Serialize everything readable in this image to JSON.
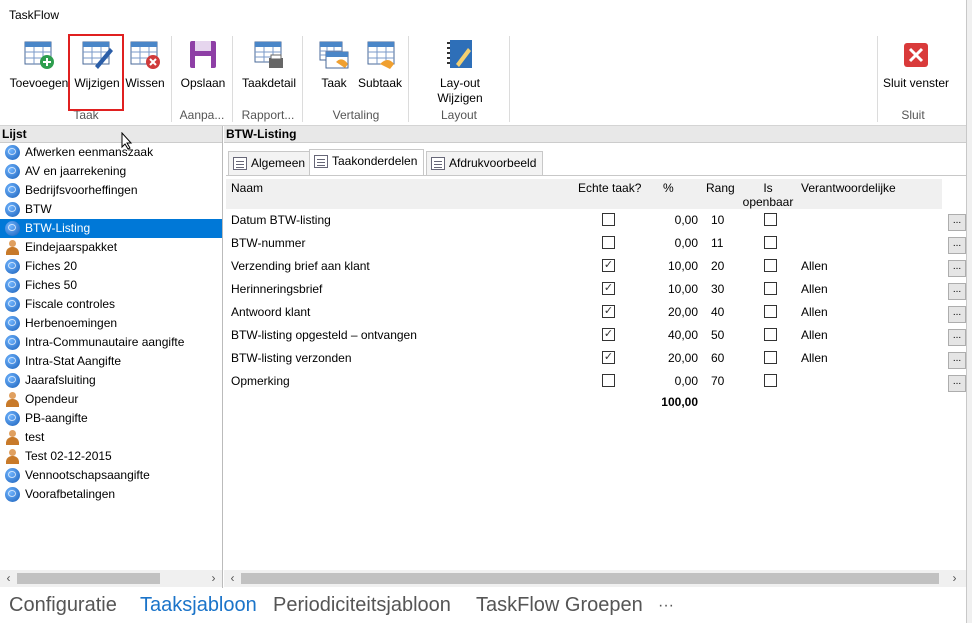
{
  "app": {
    "title": "TaskFlow"
  },
  "ribbon": {
    "buttons": {
      "add": "Toevoegen",
      "edit": "Wijzigen",
      "delete": "Wissen",
      "save": "Opslaan",
      "taskdetail": "Taakdetail",
      "task": "Taak",
      "subtask": "Subtaak",
      "layout": "Lay-out Wijzigen",
      "close": "Sluit venster"
    },
    "groups": {
      "task": "Taak",
      "adjust": "Aanpa...",
      "report": "Rapport...",
      "translation": "Vertaling",
      "layout": "Layout",
      "close": "Sluit"
    }
  },
  "list": {
    "header": "Lijst",
    "items": [
      {
        "label": "Afwerken eenmanszaak",
        "icon": "globe-icon"
      },
      {
        "label": "AV en jaarrekening",
        "icon": "globe-icon"
      },
      {
        "label": "Bedrijfsvoorheffingen",
        "icon": "globe-icon"
      },
      {
        "label": "BTW",
        "icon": "globe-icon"
      },
      {
        "label": "BTW-Listing",
        "icon": "globe-icon",
        "selected": true
      },
      {
        "label": "Eindejaarspakket",
        "icon": "person-icon"
      },
      {
        "label": "Fiches 20",
        "icon": "globe-icon"
      },
      {
        "label": "Fiches 50",
        "icon": "globe-icon"
      },
      {
        "label": "Fiscale controles",
        "icon": "globe-icon"
      },
      {
        "label": "Herbenoemingen",
        "icon": "globe-icon"
      },
      {
        "label": "Intra-Communautaire aangifte",
        "icon": "globe-icon"
      },
      {
        "label": "Intra-Stat Aangifte",
        "icon": "globe-icon"
      },
      {
        "label": "Jaarafsluiting",
        "icon": "globe-icon"
      },
      {
        "label": "Opendeur",
        "icon": "person-icon"
      },
      {
        "label": "PB-aangifte",
        "icon": "globe-icon"
      },
      {
        "label": "test",
        "icon": "person-icon"
      },
      {
        "label": "Test 02-12-2015",
        "icon": "person-icon"
      },
      {
        "label": "Vennootschapsaangifte",
        "icon": "globe-icon"
      },
      {
        "label": "Voorafbetalingen",
        "icon": "globe-icon"
      }
    ]
  },
  "detail": {
    "header": "BTW-Listing",
    "tabs": [
      {
        "label": "Algemeen"
      },
      {
        "label": "Taakonderdelen",
        "active": true
      },
      {
        "label": "Afdrukvoorbeeld"
      }
    ],
    "columns": {
      "name": "Naam",
      "real": "Echte taak?",
      "pct": "%",
      "rank": "Rang",
      "public": "Is openbaar",
      "resp": "Verantwoordelijke"
    },
    "rows": [
      {
        "name": "Datum BTW-listing",
        "real": false,
        "pct": "0,00",
        "rank": "10",
        "public": false,
        "resp": ""
      },
      {
        "name": "BTW-nummer",
        "real": false,
        "pct": "0,00",
        "rank": "11",
        "public": false,
        "resp": ""
      },
      {
        "name": "Verzending brief aan klant",
        "real": true,
        "pct": "10,00",
        "rank": "20",
        "public": false,
        "resp": "Allen"
      },
      {
        "name": "Herinneringsbrief",
        "real": true,
        "pct": "10,00",
        "rank": "30",
        "public": false,
        "resp": "Allen"
      },
      {
        "name": "Antwoord klant",
        "real": true,
        "pct": "20,00",
        "rank": "40",
        "public": false,
        "resp": "Allen"
      },
      {
        "name": "BTW-listing opgesteld – ontvangen",
        "real": true,
        "pct": "40,00",
        "rank": "50",
        "public": false,
        "resp": "Allen"
      },
      {
        "name": "BTW-listing verzonden",
        "real": true,
        "pct": "20,00",
        "rank": "60",
        "public": false,
        "resp": "Allen"
      },
      {
        "name": "Opmerking",
        "real": false,
        "pct": "0,00",
        "rank": "70",
        "public": false,
        "resp": ""
      }
    ],
    "total": "100,00",
    "row_button": "..."
  },
  "bottomnav": {
    "items": [
      "Configuratie",
      "Taaksjabloon",
      "Periodiciteitsjabloon",
      "TaskFlow Groepen"
    ],
    "active": 1,
    "more": "···"
  }
}
